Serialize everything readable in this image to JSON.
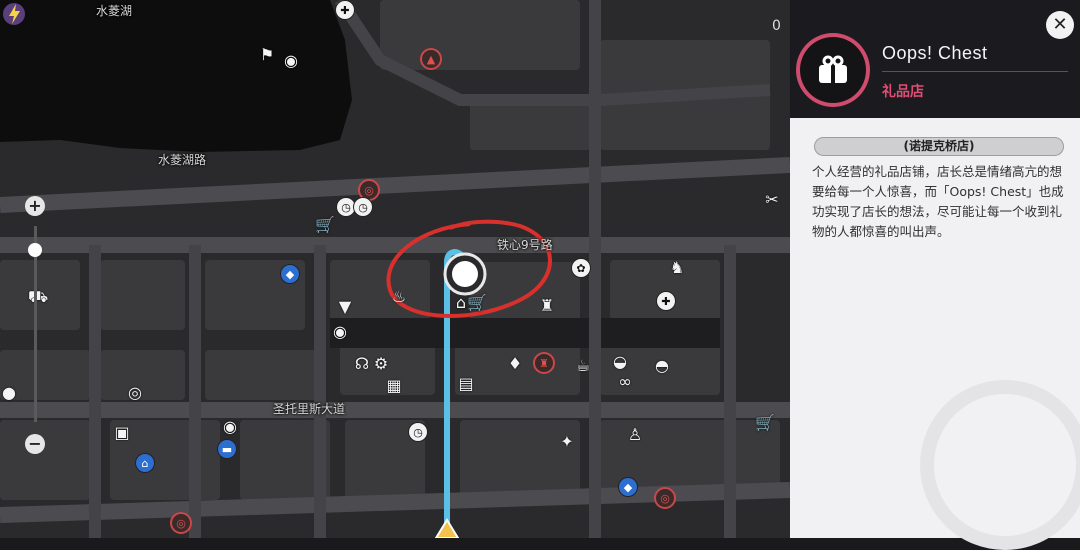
{
  "map": {
    "streets": {
      "lake": "水菱湖",
      "lake_road": "水菱湖路",
      "iron_heart": "铁心9号路",
      "st_tori": "圣托里斯大道"
    },
    "hud_value": "0"
  },
  "zoom": {
    "plus": "+",
    "minus": "−",
    "level": 0.88
  },
  "panel": {
    "shop_name": "Oops! Chest",
    "category": "礼品店",
    "area": "(诺提克桥店)",
    "description": "个人经营的礼品店铺，店长总是情绪高亢的想要给每一个人惊喜，而「Oops! Chest」也成功实现了店长的想法，尽可能让每一个收到礼物的人都惊喜的叫出声。",
    "close_label": "✕"
  },
  "colors": {
    "accent": "#d04c6e",
    "route": "#5bbfe6",
    "highlight_circle": "#d8302c"
  },
  "icons": [
    "cart-icon",
    "fork-icon",
    "camera-icon",
    "gift-icon",
    "first-aid-icon",
    "ice-cream-icon",
    "beer-icon",
    "shirt-icon",
    "car-icon",
    "shield-icon",
    "dog-icon"
  ]
}
